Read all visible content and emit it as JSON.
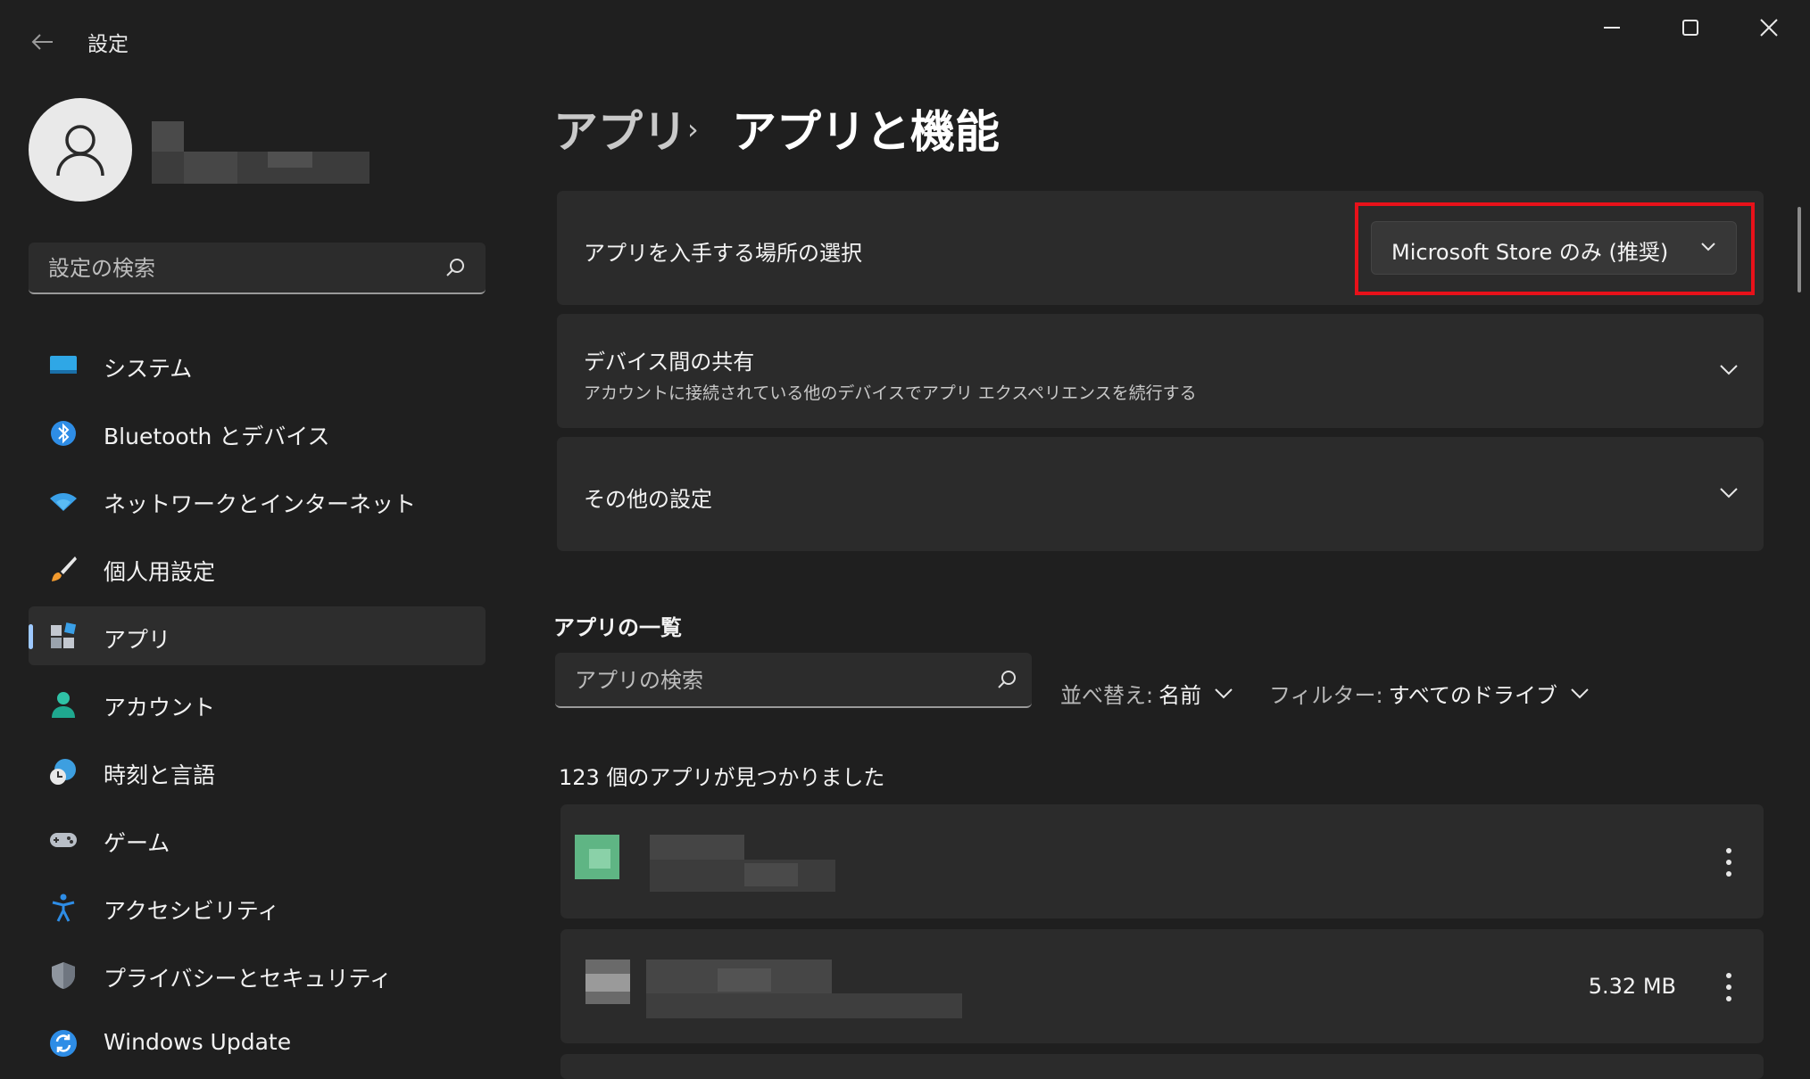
{
  "window": {
    "title": "設定",
    "back_icon": "back-arrow-icon",
    "controls": [
      "minimize-icon",
      "maximize-icon",
      "close-icon"
    ]
  },
  "sidebar": {
    "profile": {
      "avatar_icon": "user-icon"
    },
    "search": {
      "placeholder": "設定の検索",
      "icon": "search-icon"
    },
    "items": [
      {
        "label": "システム",
        "icon": "display-icon",
        "selected": false
      },
      {
        "label": "Bluetooth とデバイス",
        "icon": "bluetooth-icon",
        "selected": false
      },
      {
        "label": "ネットワークとインターネット",
        "icon": "wifi-icon",
        "selected": false
      },
      {
        "label": "個人用設定",
        "icon": "paintbrush-icon",
        "selected": false
      },
      {
        "label": "アプリ",
        "icon": "apps-icon",
        "selected": true
      },
      {
        "label": "アカウント",
        "icon": "person-icon",
        "selected": false
      },
      {
        "label": "時刻と言語",
        "icon": "globe-clock-icon",
        "selected": false
      },
      {
        "label": "ゲーム",
        "icon": "gamepad-icon",
        "selected": false
      },
      {
        "label": "アクセシビリティ",
        "icon": "accessibility-icon",
        "selected": false
      },
      {
        "label": "プライバシーとセキュリティ",
        "icon": "shield-icon",
        "selected": false
      },
      {
        "label": "Windows Update",
        "icon": "refresh-icon",
        "selected": false
      }
    ]
  },
  "main": {
    "breadcrumb": {
      "parent": "アプリ",
      "separator": "›",
      "current": "アプリと機能"
    },
    "cards": {
      "install_source": {
        "title": "アプリを入手する場所の選択",
        "dropdown_value": "Microsoft Store のみ (推奨)"
      },
      "share_across_devices": {
        "title": "デバイス間の共有",
        "subtitle": "アカウントに接続されている他のデバイスでアプリ エクスペリエンスを続行する"
      },
      "more_settings": {
        "title": "その他の設定"
      }
    },
    "app_list": {
      "heading": "アプリの一覧",
      "search_placeholder": "アプリの検索",
      "sort_label": "並べ替え:",
      "sort_value": "名前",
      "filter_label": "フィルター:",
      "filter_value": "すべてのドライブ",
      "found_text": "123 個のアプリが見つかりました",
      "apps": [
        {
          "size": ""
        },
        {
          "size": "5.32 MB"
        }
      ]
    }
  },
  "colors": {
    "background": "#1f1f1f",
    "card": "#2b2b2b",
    "accent": "#9ec9ff",
    "highlight_box": "#e8111a"
  }
}
